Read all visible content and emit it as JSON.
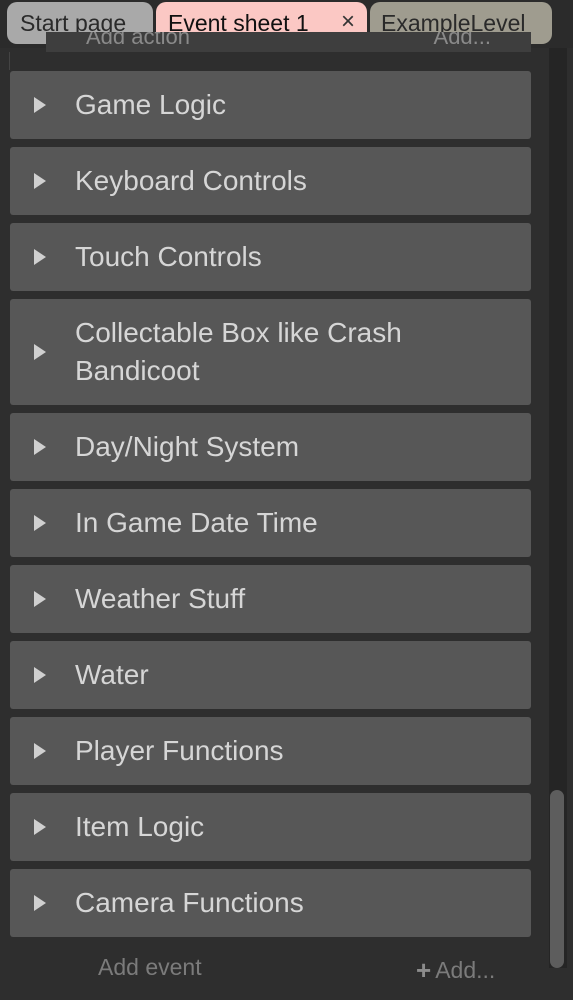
{
  "tabs": {
    "start_page": "Start page",
    "event_sheet": "Event sheet 1",
    "event_sheet_close": "×",
    "example_level": "ExampleLevel"
  },
  "previous_row": {
    "left_text": "Add action",
    "right_text": "Add..."
  },
  "groups": [
    {
      "label": "Game Logic"
    },
    {
      "label": "Keyboard Controls"
    },
    {
      "label": "Touch Controls"
    },
    {
      "label": "Collectable Box like Crash Bandicoot"
    },
    {
      "label": "Day/Night System"
    },
    {
      "label": "In Game Date Time"
    },
    {
      "label": "Weather Stuff"
    },
    {
      "label": "Water"
    },
    {
      "label": "Player Functions"
    },
    {
      "label": "Item Logic"
    },
    {
      "label": "Camera Functions"
    }
  ],
  "footer": {
    "add_event": "Add event",
    "add": "Add..."
  },
  "colors": {
    "group_bg": "#575757",
    "active_tab": "#fbc8c4"
  }
}
